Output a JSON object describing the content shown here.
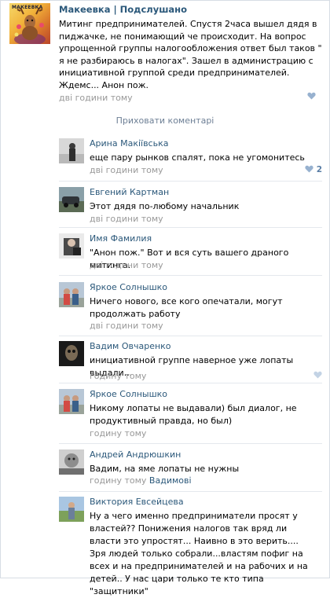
{
  "post": {
    "author": "Макеевка | Подслушано",
    "avatar_label": "МАКЕЕВКА",
    "text": "Митинг предпринимателей. Спустя 2часа вышел дядя в пиджачке, не понимающий че происходит. На вопрос упрощенной группы налогообложения ответ был таков \" я не разбираюсь в налогах\". Зашел в администрацию с инициативной группой среди предпринимателей. Ждемс... Анон пож.",
    "time": "дві години тому",
    "likes": ""
  },
  "hide_comments_label": "Приховати коментарі",
  "comments": [
    {
      "name": "Арина Макіївська",
      "text": "еще пару рынков спалят, пока не угомонитесь",
      "time": "дві години тому",
      "likes": "2"
    },
    {
      "name": "Евгений Картман",
      "text": "Этот дядя по-любому начальник",
      "time": "дві години тому",
      "likes": ""
    },
    {
      "name": "Имя Фамилия",
      "text": "\"Анон пож.\" Вот и вся суть вашего драного митинга.",
      "time": "дві години тому",
      "likes": ""
    },
    {
      "name": "Яркое Солнышко",
      "text": "Ничего нового, все кого опечатали, могут продолжать работу",
      "time": "дві години тому",
      "likes": ""
    },
    {
      "name": "Вадим Овчаренко",
      "text": "инициативной группе наверное уже лопаты выдали...",
      "time": "годину тому",
      "likes": ""
    },
    {
      "name": "Яркое Солнышко",
      "text": "Никому лопаты не выдавали) был диалог, не продуктивный правда, но был)",
      "time": "годину тому",
      "likes": ""
    },
    {
      "name": "Андрей Андрюшкин",
      "text": "Вадим, на яме лопаты не нужны",
      "time": "годину тому",
      "reply_to": "Вадимові",
      "likes": ""
    },
    {
      "name": "Виктория Евсейцева",
      "text": "Ну а чего именно предприниматели просят у властей?? Понижения налогов так вряд ли власти это упростят... Наивно в это верить.... Зря людей только собрали...властям пофиг на всех и на предпринимателей и на рабочих и на детей.. У нас цари только те кто типа \"защитники\"",
      "time": "",
      "likes": ""
    }
  ]
}
